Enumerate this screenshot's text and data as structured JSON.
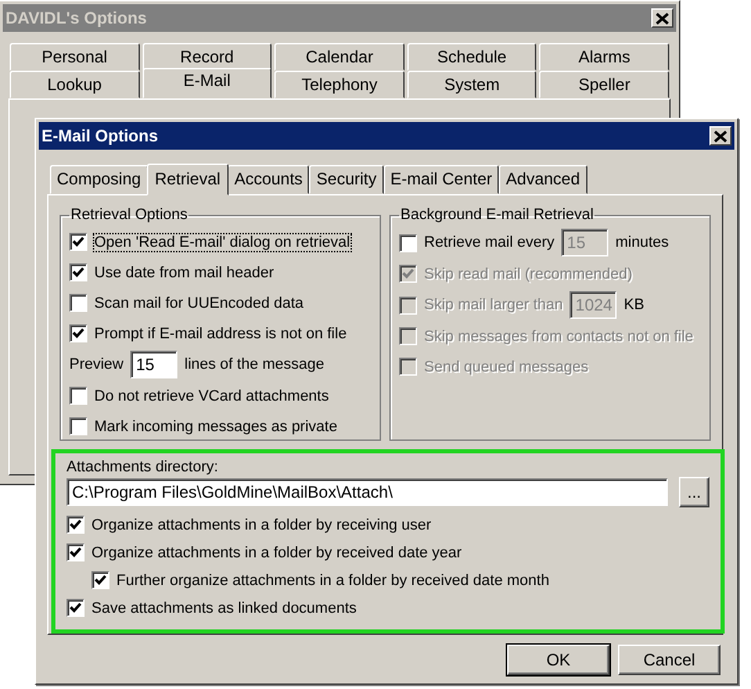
{
  "back_window": {
    "title": "DAVIDL's Options",
    "active": false,
    "tab_rows": [
      {
        "tabs": [
          {
            "label": "Personal",
            "selected": false
          },
          {
            "label": "Record",
            "selected": false
          },
          {
            "label": "Calendar",
            "selected": false
          },
          {
            "label": "Schedule",
            "selected": false
          },
          {
            "label": "Alarms",
            "selected": false
          }
        ]
      },
      {
        "tabs": [
          {
            "label": "Lookup",
            "selected": false
          },
          {
            "label": "E-Mail",
            "selected": true
          },
          {
            "label": "Telephony",
            "selected": false
          },
          {
            "label": "System",
            "selected": false
          },
          {
            "label": "Speller",
            "selected": false
          }
        ]
      }
    ]
  },
  "dialog": {
    "title": "E-Mail Options",
    "active": true,
    "tabs": [
      {
        "label": "Composing",
        "selected": false
      },
      {
        "label": "Retrieval",
        "selected": true
      },
      {
        "label": "Accounts",
        "selected": false
      },
      {
        "label": "Security",
        "selected": false
      },
      {
        "label": "E-mail Center",
        "selected": false
      },
      {
        "label": "Advanced",
        "selected": false
      }
    ],
    "groups": [
      {
        "title": "Retrieval Options",
        "items": [
          {
            "kind": "checkbox",
            "label": "Open 'Read E-mail' dialog on retrieval",
            "checked": true,
            "disabled": false,
            "focused": true
          },
          {
            "kind": "checkbox",
            "label": "Use date from mail header",
            "checked": true,
            "disabled": false,
            "focused": false
          },
          {
            "kind": "checkbox",
            "label": "Scan mail for UUEncoded data",
            "checked": false,
            "disabled": false,
            "focused": false
          },
          {
            "kind": "checkbox",
            "label": "Prompt if E-mail address is not on file",
            "checked": true,
            "disabled": false,
            "focused": false
          },
          {
            "kind": "field",
            "label": "Preview",
            "value": "15",
            "suffix": "lines of the message",
            "disabled": false
          },
          {
            "kind": "checkbox",
            "label": "Do not retrieve VCard attachments",
            "checked": false,
            "disabled": false,
            "focused": false
          },
          {
            "kind": "checkbox",
            "label": "Mark incoming messages as private",
            "checked": false,
            "disabled": false,
            "focused": false
          }
        ]
      },
      {
        "title": "Background E-mail Retrieval",
        "items": [
          {
            "kind": "checkbox",
            "label": "Retrieve mail every",
            "checked": false,
            "disabled": false,
            "focused": false,
            "value": "15",
            "value_disabled": true,
            "suffix": "minutes"
          },
          {
            "kind": "checkbox",
            "label": "Skip read mail (recommended)",
            "checked": true,
            "disabled": true,
            "focused": false
          },
          {
            "kind": "checkbox",
            "label": "Skip mail larger than",
            "checked": false,
            "disabled": true,
            "focused": false,
            "value": "1024",
            "value_disabled": true,
            "suffix": "KB"
          },
          {
            "kind": "checkbox",
            "label": "Skip messages from contacts not on file",
            "checked": false,
            "disabled": true,
            "focused": false
          },
          {
            "kind": "checkbox",
            "label": "Send queued messages",
            "checked": false,
            "disabled": true,
            "focused": false
          }
        ]
      }
    ],
    "attachments": {
      "label": "Attachments directory:",
      "path": "C:\\Program Files\\GoldMine\\MailBox\\Attach\\",
      "browse": "...",
      "options": [
        {
          "label": "Organize attachments in a folder by receiving user",
          "checked": true
        },
        {
          "label": "Organize attachments in a folder by received date year",
          "checked": true,
          "children": [
            {
              "label": "Further organize attachments in a folder by received date month",
              "checked": true
            }
          ]
        },
        {
          "label": "Save attachments as linked documents",
          "checked": true
        }
      ]
    },
    "buttons": [
      {
        "label": "OK",
        "default": true
      },
      {
        "label": "Cancel",
        "default": false
      }
    ]
  }
}
